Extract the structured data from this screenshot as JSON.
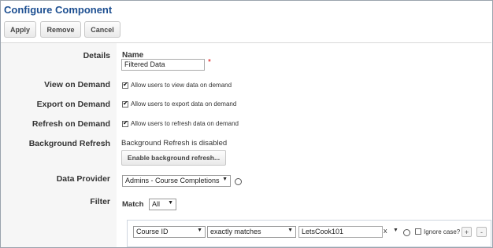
{
  "window": {
    "title": "Configure Component"
  },
  "toolbar": {
    "apply": "Apply",
    "remove": "Remove",
    "cancel": "Cancel"
  },
  "details": {
    "label": "Details",
    "name_label": "Name",
    "name_value": "Filtered Data",
    "required_mark": "*"
  },
  "view_on_demand": {
    "label": "View on Demand",
    "checkbox_label": "Allow users to view data on demand",
    "checked": true
  },
  "export_on_demand": {
    "label": "Export on Demand",
    "checkbox_label": "Allow users to export data on demand",
    "checked": true
  },
  "refresh_on_demand": {
    "label": "Refresh on Demand",
    "checkbox_label": "Allow users to refresh data on demand",
    "checked": true
  },
  "background_refresh": {
    "label": "Background Refresh",
    "status": "Background Refresh is disabled",
    "button": "Enable background refresh..."
  },
  "data_provider": {
    "label": "Data Provider",
    "selected": "Admins - Course Completions"
  },
  "filter": {
    "label": "Filter",
    "match_label": "Match",
    "match_value": "All",
    "row": {
      "field": "Course ID",
      "operator": "exactly matches",
      "value": "LetsCook101",
      "clear": "x",
      "ignore_case_label": "Ignore case?",
      "add": "+",
      "remove": "-"
    }
  }
}
